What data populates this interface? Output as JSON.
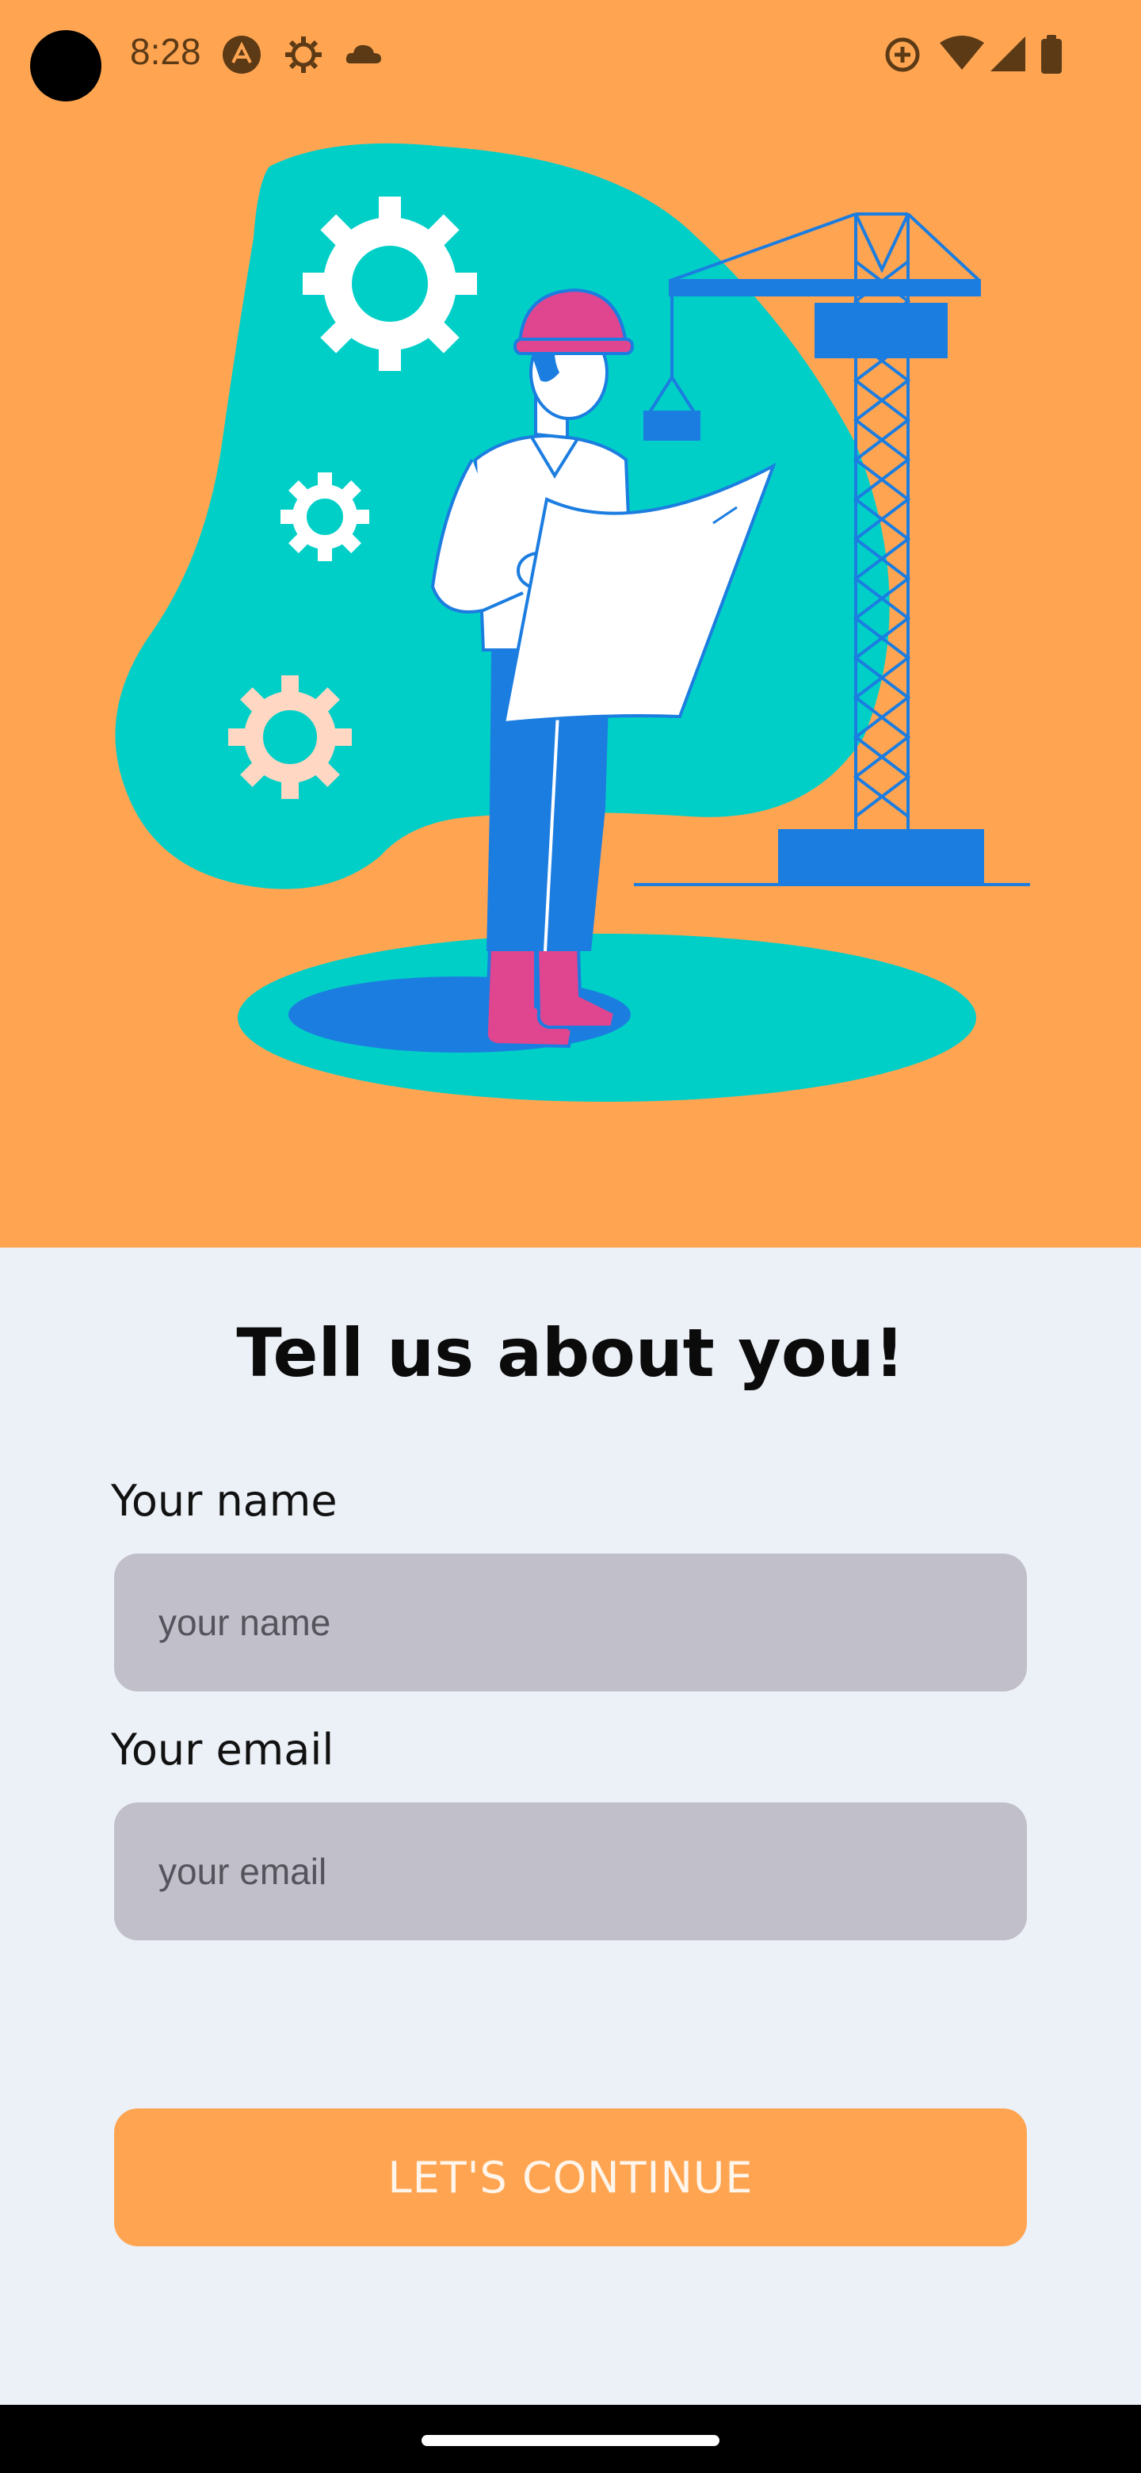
{
  "status_bar": {
    "time": "8:28",
    "icons": [
      "expo-icon",
      "settings-gear-icon",
      "cloud-icon",
      "data-saver-icon",
      "wifi-icon",
      "cellular-signal-icon",
      "battery-icon"
    ]
  },
  "illustration": {
    "subject": "engineer-with-blueprint-and-crane",
    "colors": {
      "background": "#ffa552",
      "blob": "#00cfc8",
      "accent_blue": "#1c7de0",
      "helmet_pink": "#e0458f",
      "gear_light": "#ffd7c2"
    }
  },
  "form": {
    "title": "Tell us about you!",
    "name_label": "Your name",
    "name_placeholder": "your name",
    "email_label": "Your email",
    "email_placeholder": "your email",
    "submit_label": "LET'S CONTINUE"
  },
  "colors": {
    "primary": "#ffa552",
    "form_background": "#ecf1f8",
    "input_background": "#c1bfc9"
  }
}
